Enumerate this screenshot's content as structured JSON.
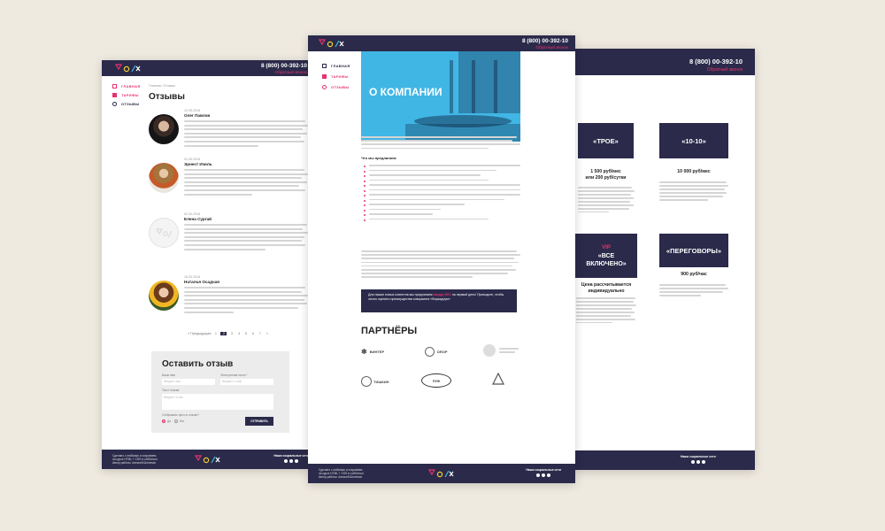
{
  "colors": {
    "dark": "#2b2a4a",
    "accent": "#e8336e",
    "hero": "#40b6e5",
    "bg": "#efeae0"
  },
  "header": {
    "phone": "8 (800) 00-392-10",
    "callback": "Обратный звонок"
  },
  "nav": [
    {
      "label": "ГЛАВНАЯ",
      "icon": "home-icon"
    },
    {
      "label": "ТАРИФЫ",
      "icon": "tariff-icon"
    },
    {
      "label": "ОТЗЫВЫ",
      "icon": "reviews-icon"
    }
  ],
  "reviews_page": {
    "breadcrumb": "Главная / Отзывы",
    "title": "Отзывы",
    "reviews": [
      {
        "date": "12.05.2018",
        "name": "Олег Павлов"
      },
      {
        "date": "01.05.2018",
        "name": "Эрнест Изиль"
      },
      {
        "date": "02.04.2018",
        "name": "Елена Сургай"
      },
      {
        "date": "16.03.2018",
        "name": "Наталья Осадчая"
      }
    ],
    "pagination": {
      "prev": "« Предыдущая",
      "pages": [
        "1",
        "2",
        "3",
        "4",
        "5",
        "6",
        "7"
      ],
      "current": "2",
      "next": "»"
    },
    "form": {
      "title": "Оставить отзыв",
      "name_label": "Ваше имя",
      "name_placeholder": "Введите имя",
      "email_label": "Электронная почта *",
      "email_placeholder": "Введите e-mail",
      "text_label": "Текст отзыва",
      "text_placeholder": "Введите отзыв",
      "radio_label": "Отображать фото в отзыве?",
      "radio_yes": "Да",
      "radio_no": "Нет",
      "submit": "ОТПРАВИТЬ"
    }
  },
  "about_page": {
    "hero_title": "О КОМПАНИИ",
    "offer_title": "Что мы предлагаем:",
    "promo_prefix": "Для наших новых клиентов мы предлагаем",
    "promo_highlight": "скидку 50%",
    "promo_suffix": "на первый день! Приходите, чтобы лично оценить преимущества коворкинга «Воркадиум»",
    "partners_title": "ПАРТНЁРЫ",
    "partners": [
      "ВИНТЕР",
      "DROP",
      "ТИШКИН",
      "ПУФ"
    ]
  },
  "tariffs_page": {
    "cards": [
      {
        "name": "«ТРОЕ»",
        "price_line1": "1 500 руб/мес",
        "price_line2": "или 200 руб/сутки"
      },
      {
        "name": "«10-10»",
        "price_line1": "10 000 руб/мес",
        "price_line2": ""
      },
      {
        "name_top": "VIP",
        "name_bottom": "«ВСЕ ВКЛЮЧЕНО»",
        "price_line1": "Цена рассчитывается",
        "price_line2": "индивидуально"
      },
      {
        "name": "«ПЕРЕГОВОРЫ»",
        "price_line1": "900 руб/час",
        "price_line2": ""
      }
    ]
  },
  "footer": {
    "line1": "Сделано с любовью и старанием",
    "line2": "на курсе HTML + CSS в LoftSchool",
    "line3": "Автор работы: Алексей Шелепов",
    "social": "Наши социальные сети"
  }
}
